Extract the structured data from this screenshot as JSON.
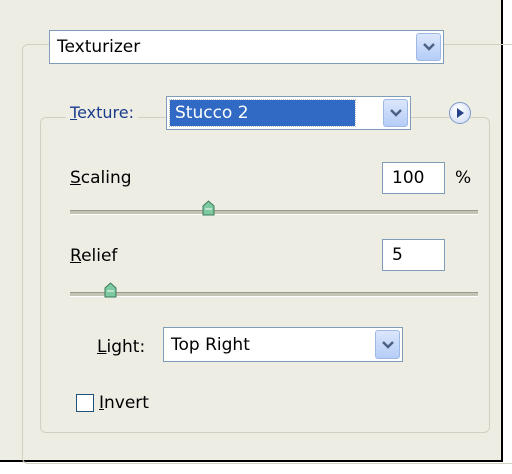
{
  "filter": {
    "selected": "Texturizer"
  },
  "texture": {
    "label_prefix": "T",
    "label_rest": "exture:",
    "selected": "Stucco 2"
  },
  "scaling": {
    "label_first": "S",
    "label_rest": "caling",
    "value": "100",
    "unit": "%",
    "slider_fraction": 0.34
  },
  "relief": {
    "label_first": "R",
    "label_rest": "elief",
    "value": "5",
    "slider_fraction": 0.1
  },
  "light": {
    "label_first": "L",
    "label_rest": "ight:",
    "selected": "Top Right"
  },
  "invert": {
    "label_first": "I",
    "label_rest": "nvert",
    "checked": false
  },
  "icons": [
    "chevron-down-icon",
    "play-arrow-icon",
    "slider-thumb-icon",
    "checkbox-icon"
  ],
  "colors": {
    "panel_bg": "#eeede4",
    "field_border": "#7f9db9",
    "selection_bg": "#316ac5",
    "accent_label": "#1a3c8c"
  }
}
